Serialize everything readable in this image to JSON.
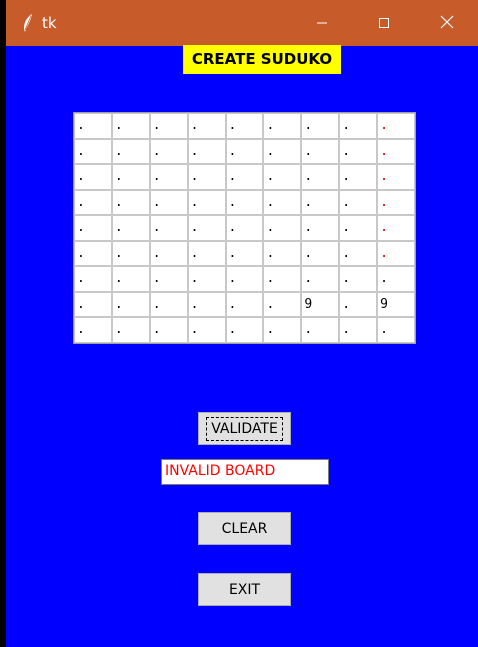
{
  "window": {
    "title": "tk",
    "titlebar_color": "#c75b29",
    "background_color": "#0000ff",
    "icons": [
      "feather-icon",
      "minimize-icon",
      "maximize-icon",
      "close-icon"
    ]
  },
  "heading": {
    "text": "CREATE SUDUKO",
    "background": "#ffff00"
  },
  "board": {
    "rows": [
      [
        ".",
        ".",
        ".",
        ".",
        ".",
        ".",
        ".",
        ".",
        "."
      ],
      [
        ".",
        ".",
        ".",
        ".",
        ".",
        ".",
        ".",
        ".",
        "."
      ],
      [
        ".",
        ".",
        ".",
        ".",
        ".",
        ".",
        ".",
        ".",
        "."
      ],
      [
        ".",
        ".",
        ".",
        ".",
        ".",
        ".",
        ".",
        ".",
        "."
      ],
      [
        ".",
        ".",
        ".",
        ".",
        ".",
        ".",
        ".",
        ".",
        "."
      ],
      [
        ".",
        ".",
        ".",
        ".",
        ".",
        ".",
        ".",
        ".",
        "."
      ],
      [
        ".",
        ".",
        ".",
        ".",
        ".",
        ".",
        ".",
        ".",
        "."
      ],
      [
        ".",
        ".",
        ".",
        ".",
        ".",
        ".",
        "9",
        ".",
        "9"
      ],
      [
        ".",
        ".",
        ".",
        ".",
        ".",
        ".",
        ".",
        ".",
        "."
      ]
    ],
    "red_column": 8,
    "red_rows": [
      0,
      1,
      2,
      3,
      4,
      5
    ]
  },
  "buttons": {
    "validate": "VALIDATE",
    "clear": "CLEAR",
    "exit": "EXIT"
  },
  "status": {
    "text": "INVALID BOARD",
    "color": "#ff0000"
  }
}
